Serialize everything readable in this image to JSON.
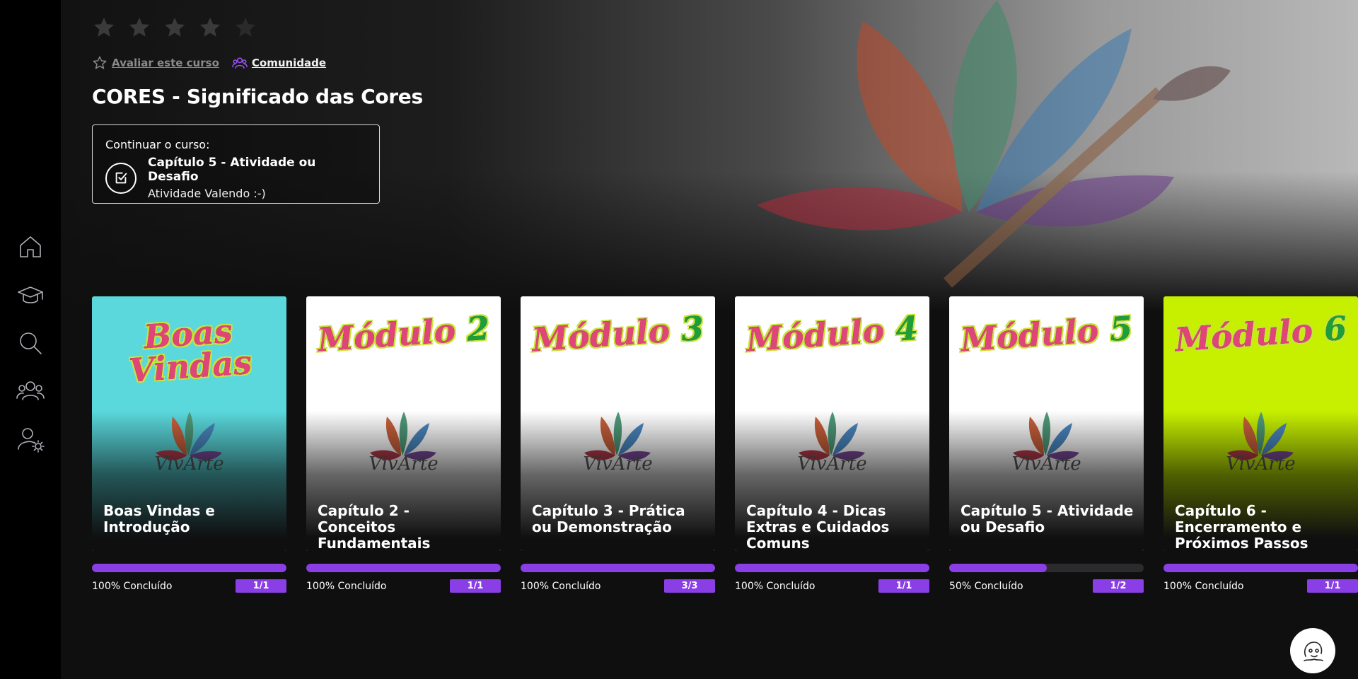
{
  "rating": {
    "stars": 5,
    "filled": 0
  },
  "links": {
    "rate_label": "Avaliar este curso",
    "community_label": "Comunidade"
  },
  "course": {
    "title": "CORES - Significado das Cores",
    "continue_label": "Continuar o curso:",
    "continue_chapter": "Capítulo 5 - Atividade ou Desafio",
    "continue_activity": "Atividade Valendo :-)"
  },
  "sidebar": {
    "items": [
      {
        "name": "home",
        "icon": "home-icon"
      },
      {
        "name": "courses",
        "icon": "graduation-cap-icon"
      },
      {
        "name": "search",
        "icon": "search-icon"
      },
      {
        "name": "community",
        "icon": "users-icon"
      },
      {
        "name": "account-settings",
        "icon": "user-gear-icon"
      }
    ]
  },
  "modules": [
    {
      "thumb_line1": "Boas",
      "thumb_line2": "Vindas",
      "brand": "VivArte",
      "bg": "#5ad8dc",
      "name": "Boas Vindas e Introdução",
      "progress_label": "100% Concluído",
      "progress": 1.0,
      "count": "1/1"
    },
    {
      "thumb_line1": "Módulo",
      "thumb_line2": "2",
      "brand": "VivArte",
      "bg": "#ffffff",
      "name": "Capítulo 2 - Conceitos Fundamentais",
      "progress_label": "100% Concluído",
      "progress": 1.0,
      "count": "1/1"
    },
    {
      "thumb_line1": "Módulo",
      "thumb_line2": "3",
      "brand": "VivArte",
      "bg": "#ffffff",
      "name": "Capítulo 3 - Prática ou Demonstração",
      "progress_label": "100% Concluído",
      "progress": 1.0,
      "count": "3/3"
    },
    {
      "thumb_line1": "Módulo",
      "thumb_line2": "4",
      "brand": "VivArte",
      "bg": "#ffffff",
      "name": "Capítulo 4 - Dicas Extras e Cuidados Comuns",
      "progress_label": "100% Concluído",
      "progress": 1.0,
      "count": "1/1"
    },
    {
      "thumb_line1": "Módulo",
      "thumb_line2": "5",
      "brand": "VivArte",
      "bg": "#ffffff",
      "name": "Capítulo 5 - Atividade ou Desafio",
      "progress_label": "50% Concluído",
      "progress": 0.5,
      "count": "1/2"
    },
    {
      "thumb_line1": "Módulo",
      "thumb_line2": "6",
      "brand": "VivArte",
      "bg": "#c6f000",
      "name": "Capítulo 6 - Encerramento e Próximos Passos",
      "progress_label": "100% Concluído",
      "progress": 1.0,
      "count": "1/1"
    }
  ],
  "colors": {
    "accent": "#8a3ee6",
    "background": "#0f0f10",
    "sidebar": "#000000"
  }
}
